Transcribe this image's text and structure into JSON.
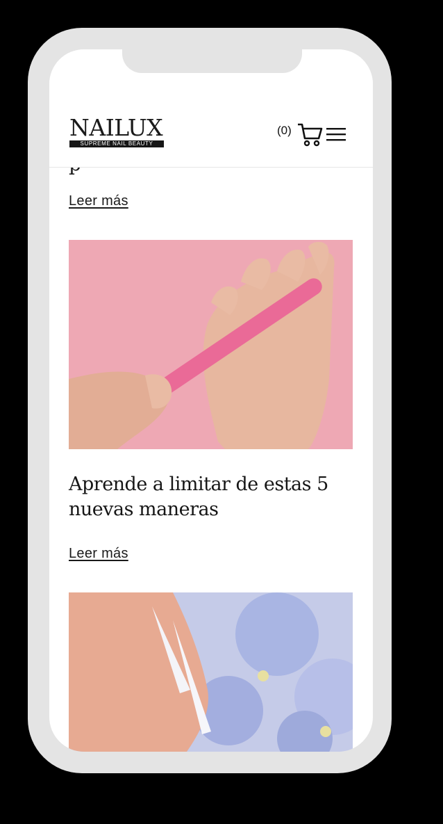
{
  "header": {
    "logo_word": "NAILUX",
    "logo_tagline": "SUPREME NAIL BEAUTY",
    "cart_count": "(0)"
  },
  "posts": [
    {
      "read_more": "Leer más"
    },
    {
      "title": "Aprende a limitar de estas 5 nuevas maneras",
      "read_more": "Leer más"
    }
  ],
  "icons": [
    "cart-icon",
    "menu-icon"
  ],
  "colors": {
    "text": "#1a1a1a",
    "frame": "#e4e4e4",
    "pink": "#eea8b4"
  }
}
